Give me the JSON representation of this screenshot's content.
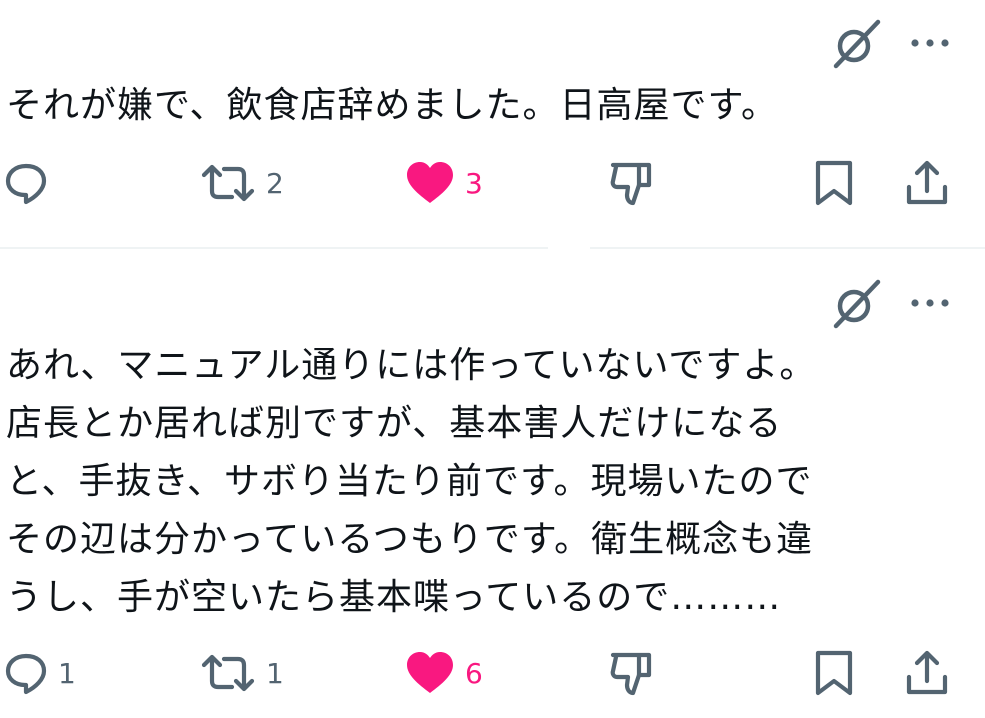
{
  "colors": {
    "text": "#0f1419",
    "icon": "#536471",
    "like": "#f91880",
    "divider": "#eff3f4"
  },
  "icons": {
    "grok": "grok-icon",
    "more": "more-icon",
    "reply": "reply-icon",
    "retweet": "retweet-icon",
    "like": "heart-icon",
    "dislike": "downvote-icon",
    "bookmark": "bookmark-icon",
    "share": "share-icon"
  },
  "tweets": [
    {
      "text": "それが嫌で、飲食店辞めました。日高屋です。",
      "replies": "",
      "retweets": "2",
      "likes": "3",
      "liked": true
    },
    {
      "text": "あれ、マニュアル通りには作っていないですよ。\n店長とか居れば別ですが、基本害人だけになる\nと、手抜き、サボり当たり前です。現場いたので\nその辺は分かっているつもりです。衛生概念も違\nうし、手が空いたら基本喋っているので………",
      "replies": "1",
      "retweets": "1",
      "likes": "6",
      "liked": true
    }
  ]
}
